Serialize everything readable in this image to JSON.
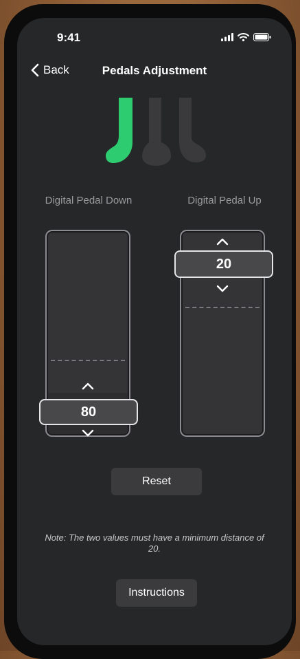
{
  "status_bar": {
    "time": "9:41"
  },
  "header": {
    "back_label": "Back",
    "title": "Pedals Adjustment"
  },
  "colors": {
    "accent": "#2ecc71",
    "inactive_pedal": "#3a3a3d",
    "background": "#262728"
  },
  "pedal_down": {
    "label": "Digital Pedal Down",
    "value": "80"
  },
  "pedal_up": {
    "label": "Digital Pedal Up",
    "value": "20"
  },
  "buttons": {
    "reset": "Reset",
    "instructions": "Instructions"
  },
  "note": "Note: The two values must have a minimum distance of 20."
}
